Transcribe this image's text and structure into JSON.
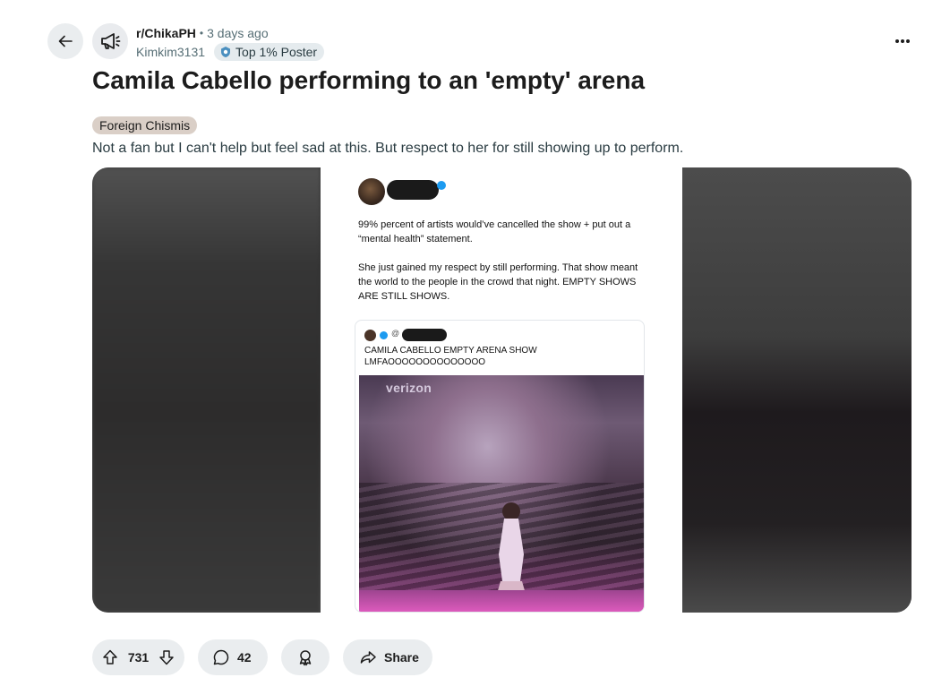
{
  "post": {
    "subreddit": "r/ChikaPH",
    "separator": "•",
    "time_ago": "3 days ago",
    "author": "Kimkim3131",
    "author_badge": "Top 1% Poster",
    "title": "Camila Cabello performing to an 'empty' arena",
    "flair": "Foreign Chismis",
    "body": "Not a fan but I can't help but feel sad at this. But respect to her for still showing up to perform."
  },
  "embedded_tweet": {
    "text": "99% percent of artists would’ve cancelled the show + put out a “mental health” statement.\n\nShe just gained my respect by still performing. That show meant the world to the people in the crowd that night. EMPTY SHOWS ARE STILL SHOWS.",
    "quote_handle_prefix": "@",
    "quote_text": "CAMILA CABELLO EMPTY ARENA SHOW\nLMFAOOOOOOOOOOOOOO",
    "photo_brand": "verizon"
  },
  "actions": {
    "upvotes": "731",
    "comments": "42",
    "share_label": "Share"
  },
  "icons": {
    "back": "arrow-left-icon",
    "subreddit": "megaphone-icon",
    "badge": "badge-icon",
    "more": "more-horizontal-icon",
    "upvote": "upvote-icon",
    "downvote": "downvote-icon",
    "comment": "comment-icon",
    "award": "award-icon",
    "share": "share-icon"
  },
  "colors": {
    "pill_bg": "#eaedef",
    "flair_bg": "#dacfc7",
    "verified_blue": "#1d9bf0"
  }
}
